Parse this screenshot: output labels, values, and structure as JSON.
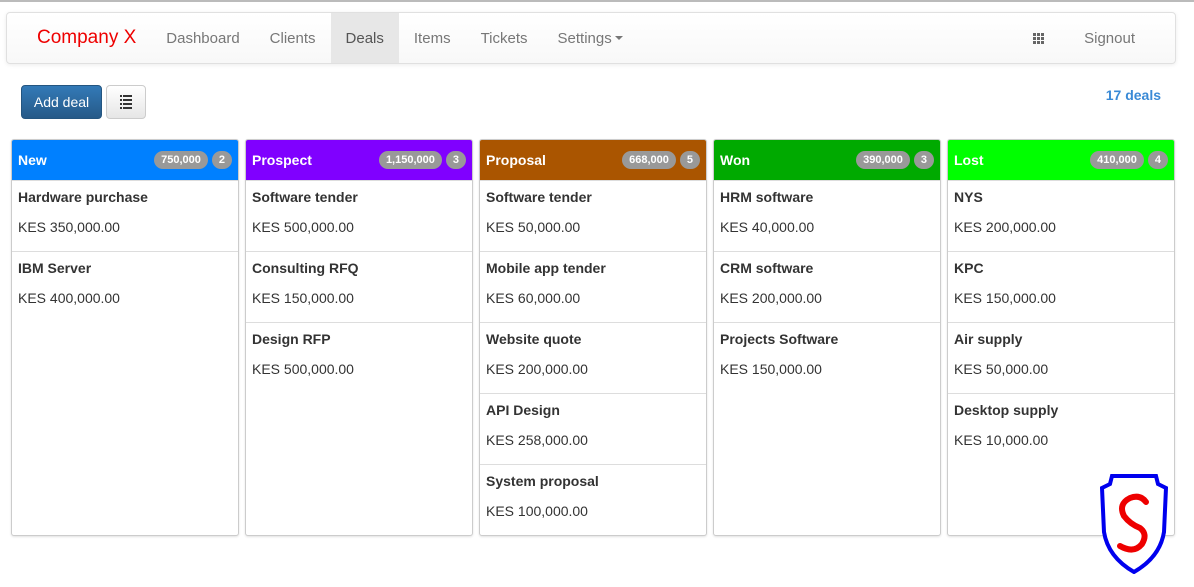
{
  "navbar": {
    "brand": "Company X",
    "items": [
      {
        "label": "Dashboard",
        "active": false
      },
      {
        "label": "Clients",
        "active": false
      },
      {
        "label": "Deals",
        "active": true
      },
      {
        "label": "Items",
        "active": false
      },
      {
        "label": "Tickets",
        "active": false
      },
      {
        "label": "Settings",
        "active": false,
        "dropdown": true
      }
    ],
    "apps_icon": "grid-icon",
    "signout": "Signout"
  },
  "toolbar": {
    "add_label": "Add deal",
    "list_icon": "list-icon",
    "deal_count": "17 deals"
  },
  "columns": [
    {
      "title": "New",
      "color": "#0080ff",
      "total": "750,000",
      "count": "2",
      "deals": [
        {
          "name": "Hardware purchase",
          "amount": "KES 350,000.00"
        },
        {
          "name": "IBM Server",
          "amount": "KES 400,000.00"
        }
      ]
    },
    {
      "title": "Prospect",
      "color": "#8000ff",
      "total": "1,150,000",
      "count": "3",
      "deals": [
        {
          "name": "Software tender",
          "amount": "KES 500,000.00"
        },
        {
          "name": "Consulting RFQ",
          "amount": "KES 150,000.00"
        },
        {
          "name": "Design RFP",
          "amount": "KES 500,000.00"
        }
      ]
    },
    {
      "title": "Proposal",
      "color": "#aa5500",
      "total": "668,000",
      "count": "5",
      "deals": [
        {
          "name": "Software tender",
          "amount": "KES 50,000.00"
        },
        {
          "name": "Mobile app tender",
          "amount": "KES 60,000.00"
        },
        {
          "name": "Website quote",
          "amount": "KES 200,000.00"
        },
        {
          "name": "API Design",
          "amount": "KES 258,000.00"
        },
        {
          "name": "System proposal",
          "amount": "KES 100,000.00"
        }
      ]
    },
    {
      "title": "Won",
      "color": "#00aa00",
      "total": "390,000",
      "count": "3",
      "deals": [
        {
          "name": "HRM software",
          "amount": "KES 40,000.00"
        },
        {
          "name": "CRM software",
          "amount": "KES 200,000.00"
        },
        {
          "name": "Projects Software",
          "amount": "KES 150,000.00"
        }
      ]
    },
    {
      "title": "Lost",
      "color": "#00ff00",
      "total": "410,000",
      "count": "4",
      "deals": [
        {
          "name": "NYS",
          "amount": "KES 200,000.00"
        },
        {
          "name": "KPC",
          "amount": "KES 150,000.00"
        },
        {
          "name": "Air supply",
          "amount": "KES 50,000.00"
        },
        {
          "name": "Desktop supply",
          "amount": "KES 10,000.00"
        }
      ]
    }
  ],
  "logo": {
    "icon": "shield-s-logo",
    "border_color": "#0000ee",
    "letter_color": "#ee0000",
    "letter": "S"
  }
}
